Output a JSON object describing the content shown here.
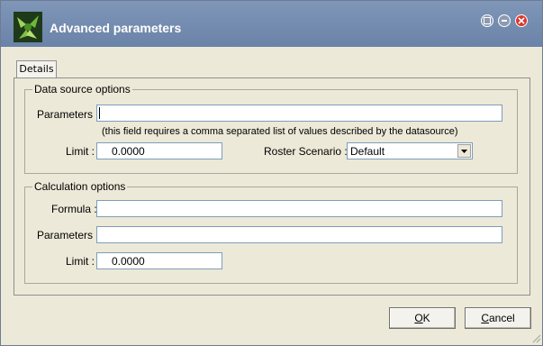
{
  "window": {
    "title": "Advanced parameters",
    "controls": [
      "restore-icon",
      "minimize-icon",
      "close-icon"
    ],
    "accent_color": "#7f96b8",
    "close_color": "#d8392f"
  },
  "tabs": [
    {
      "label": "Details",
      "selected": true
    }
  ],
  "data_source_options": {
    "legend": "Data source options",
    "parameters_label": "Parameters :",
    "parameters_value": "",
    "hint": "(this field requires a comma separated list of values described by the datasource)",
    "limit_label": "Limit :",
    "limit_value": "0.0000",
    "roster_label": "Roster Scenario :",
    "roster_value": "Default"
  },
  "calculation_options": {
    "legend": "Calculation options",
    "formula_label": "Formula :",
    "formula_value": "",
    "parameters_label": "Parameters :",
    "parameters_value": "",
    "limit_label": "Limit :",
    "limit_value": "0.0000"
  },
  "buttons": {
    "ok_mnemonic": "O",
    "ok_rest": "K",
    "cancel_mnemonic": "C",
    "cancel_rest": "ancel"
  }
}
